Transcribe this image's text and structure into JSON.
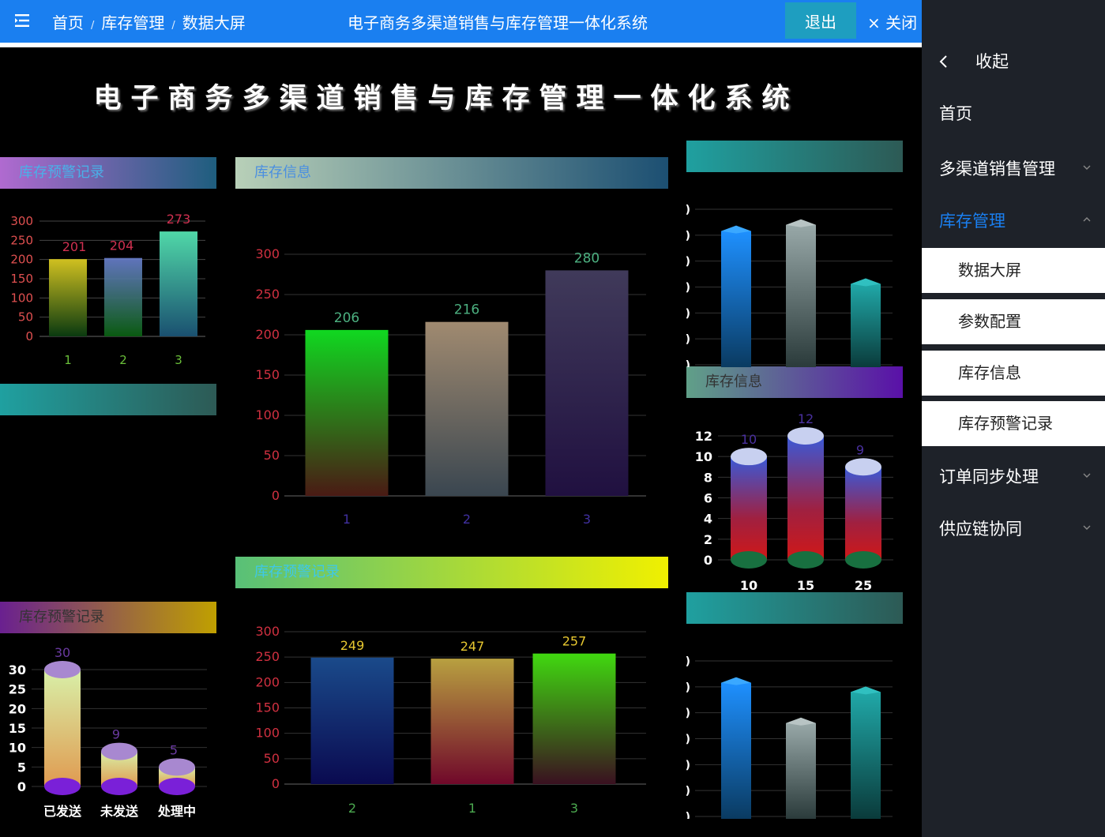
{
  "header": {
    "breadcrumb": [
      "首页",
      "库存管理",
      "数据大屏"
    ],
    "title": "电子商务多渠道销售与库存管理一体化系统",
    "logout_label": "退出",
    "close_label": "× 关闭",
    "menu_icon": "menu-fold-icon",
    "bg_color": "#1a7ff0"
  },
  "dashboard": {
    "title": "电子商务多渠道销售与库存管理一体化系统",
    "panels": {
      "left_top": "库存预警记录",
      "left_mid": "",
      "left_bottom": "库存预警记录",
      "center_top": "库存信息",
      "center_bottom": "库存预警记录",
      "right_top": "",
      "right_mid": "库存信息",
      "right_bottom": ""
    }
  },
  "sidebar": {
    "collapse_label": "收起",
    "items": [
      {
        "label": "首页",
        "expandable": false
      },
      {
        "label": "多渠道销售管理",
        "expandable": true
      },
      {
        "label": "库存管理",
        "expandable": true,
        "expanded": true,
        "active": true
      },
      {
        "label": "订单同步处理",
        "expandable": true
      },
      {
        "label": "供应链协同",
        "expandable": true
      }
    ],
    "sub_items": [
      "数据大屏",
      "参数配置",
      "库存信息",
      "库存预警记录"
    ],
    "active_color": "#1a7ff0"
  },
  "chart_data": [
    {
      "id": "left_top",
      "type": "bar",
      "categories": [
        "1",
        "2",
        "3"
      ],
      "values": [
        201,
        204,
        273
      ],
      "ylim": [
        0,
        300
      ],
      "yticks": [
        0,
        50,
        100,
        150,
        200,
        250,
        300
      ]
    },
    {
      "id": "center_top",
      "type": "bar",
      "categories": [
        "1",
        "2",
        "3"
      ],
      "values": [
        206,
        216,
        280
      ],
      "ylim": [
        0,
        300
      ],
      "yticks": [
        0,
        50,
        100,
        150,
        200,
        250,
        300
      ]
    },
    {
      "id": "center_bottom",
      "type": "bar",
      "categories": [
        "2",
        "1",
        "3"
      ],
      "values": [
        249,
        247,
        257
      ],
      "ylim": [
        0,
        300
      ],
      "yticks": [
        0,
        50,
        100,
        150,
        200,
        250,
        300
      ]
    },
    {
      "id": "left_bottom",
      "type": "bar",
      "categories": [
        "已发送",
        "未发送",
        "处理中"
      ],
      "values": [
        30,
        9,
        5
      ],
      "ylim": [
        0,
        30
      ],
      "yticks": [
        0,
        5,
        10,
        15,
        20,
        25,
        30
      ]
    },
    {
      "id": "right_mid",
      "type": "bar",
      "categories": [
        "10",
        "15",
        "25"
      ],
      "values": [
        10,
        12,
        9
      ],
      "ylim": [
        0,
        12
      ],
      "yticks": [
        0,
        2,
        4,
        6,
        8,
        10,
        12
      ]
    },
    {
      "id": "right_top",
      "type": "bar",
      "values": [
        0.86,
        0.9,
        0.52
      ],
      "ylim": [
        0,
        1
      ]
    },
    {
      "id": "right_bottom",
      "type": "bar",
      "values": [
        0.86,
        0.6,
        0.8
      ],
      "ylim": [
        0,
        1
      ]
    }
  ]
}
